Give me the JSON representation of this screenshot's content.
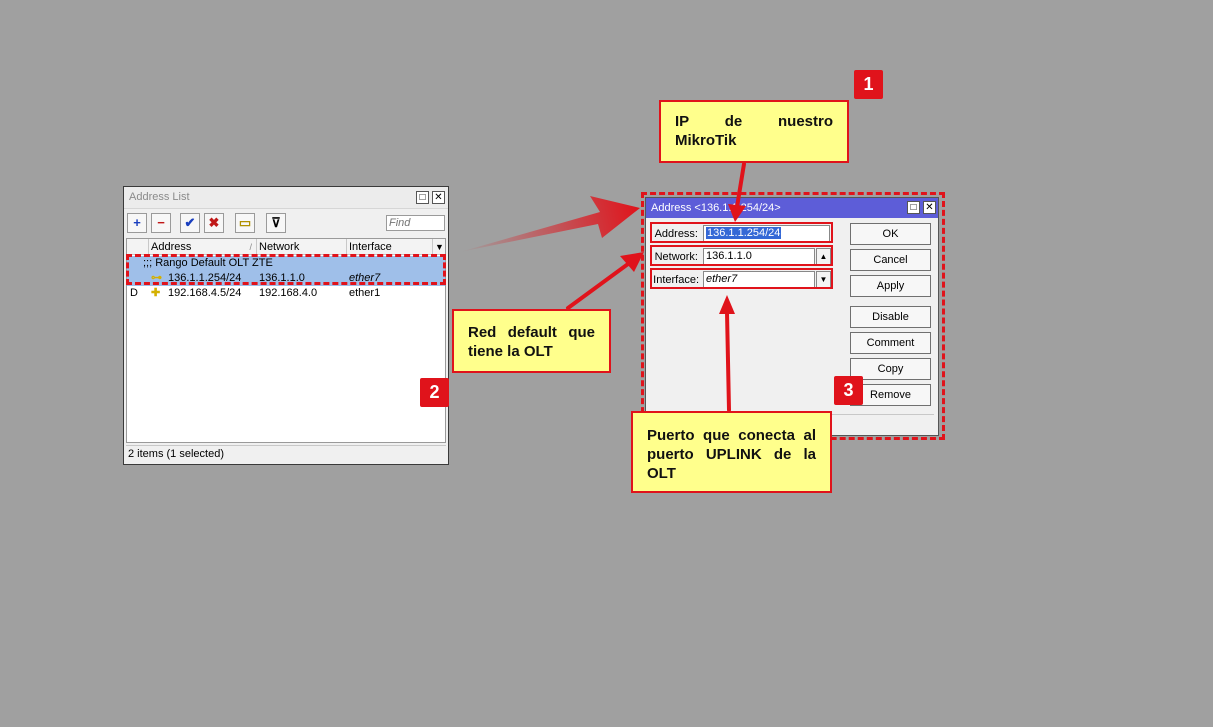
{
  "address_list": {
    "title": "Address List",
    "toolbar": {
      "add": "+",
      "remove": "−",
      "enable": "✔",
      "disable": "✖",
      "comment": "▭",
      "filter": "⊽",
      "find_placeholder": "Find"
    },
    "columns": [
      "Address",
      "Network",
      "Interface"
    ],
    "comment_row": ";;; Rango Default OLT ZTE",
    "rows": [
      {
        "flag": "",
        "address": "136.1.1.254/24",
        "network": "136.1.1.0",
        "interface": "ether7"
      },
      {
        "flag": "D",
        "address": "192.168.4.5/24",
        "network": "192.168.4.0",
        "interface": "ether1"
      }
    ],
    "status": "2 items (1 selected)"
  },
  "address_dialog": {
    "title": "Address <136.1.1.254/24>",
    "fields": {
      "address_label": "Address:",
      "address_value": "136.1.1.254/24",
      "network_label": "Network:",
      "network_value": "136.1.1.0",
      "interface_label": "Interface:",
      "interface_value": "ether7"
    },
    "buttons": {
      "ok": "OK",
      "cancel": "Cancel",
      "apply": "Apply",
      "disable": "Disable",
      "comment": "Comment",
      "copy": "Copy",
      "remove": "Remove"
    }
  },
  "callouts": {
    "ip": "IP de nuestro MikroTik",
    "red": "Red default que tiene la OLT",
    "puerto": "Puerto que conecta al puerto UPLINK de la OLT"
  },
  "badges": {
    "one": "1",
    "two": "2",
    "three": "3"
  },
  "colors": {
    "accent_red": "#e0131b",
    "callout_bg": "#ffff8c",
    "dialog_title": "#5d5dd8",
    "selected_row": "#9fbfe9"
  }
}
